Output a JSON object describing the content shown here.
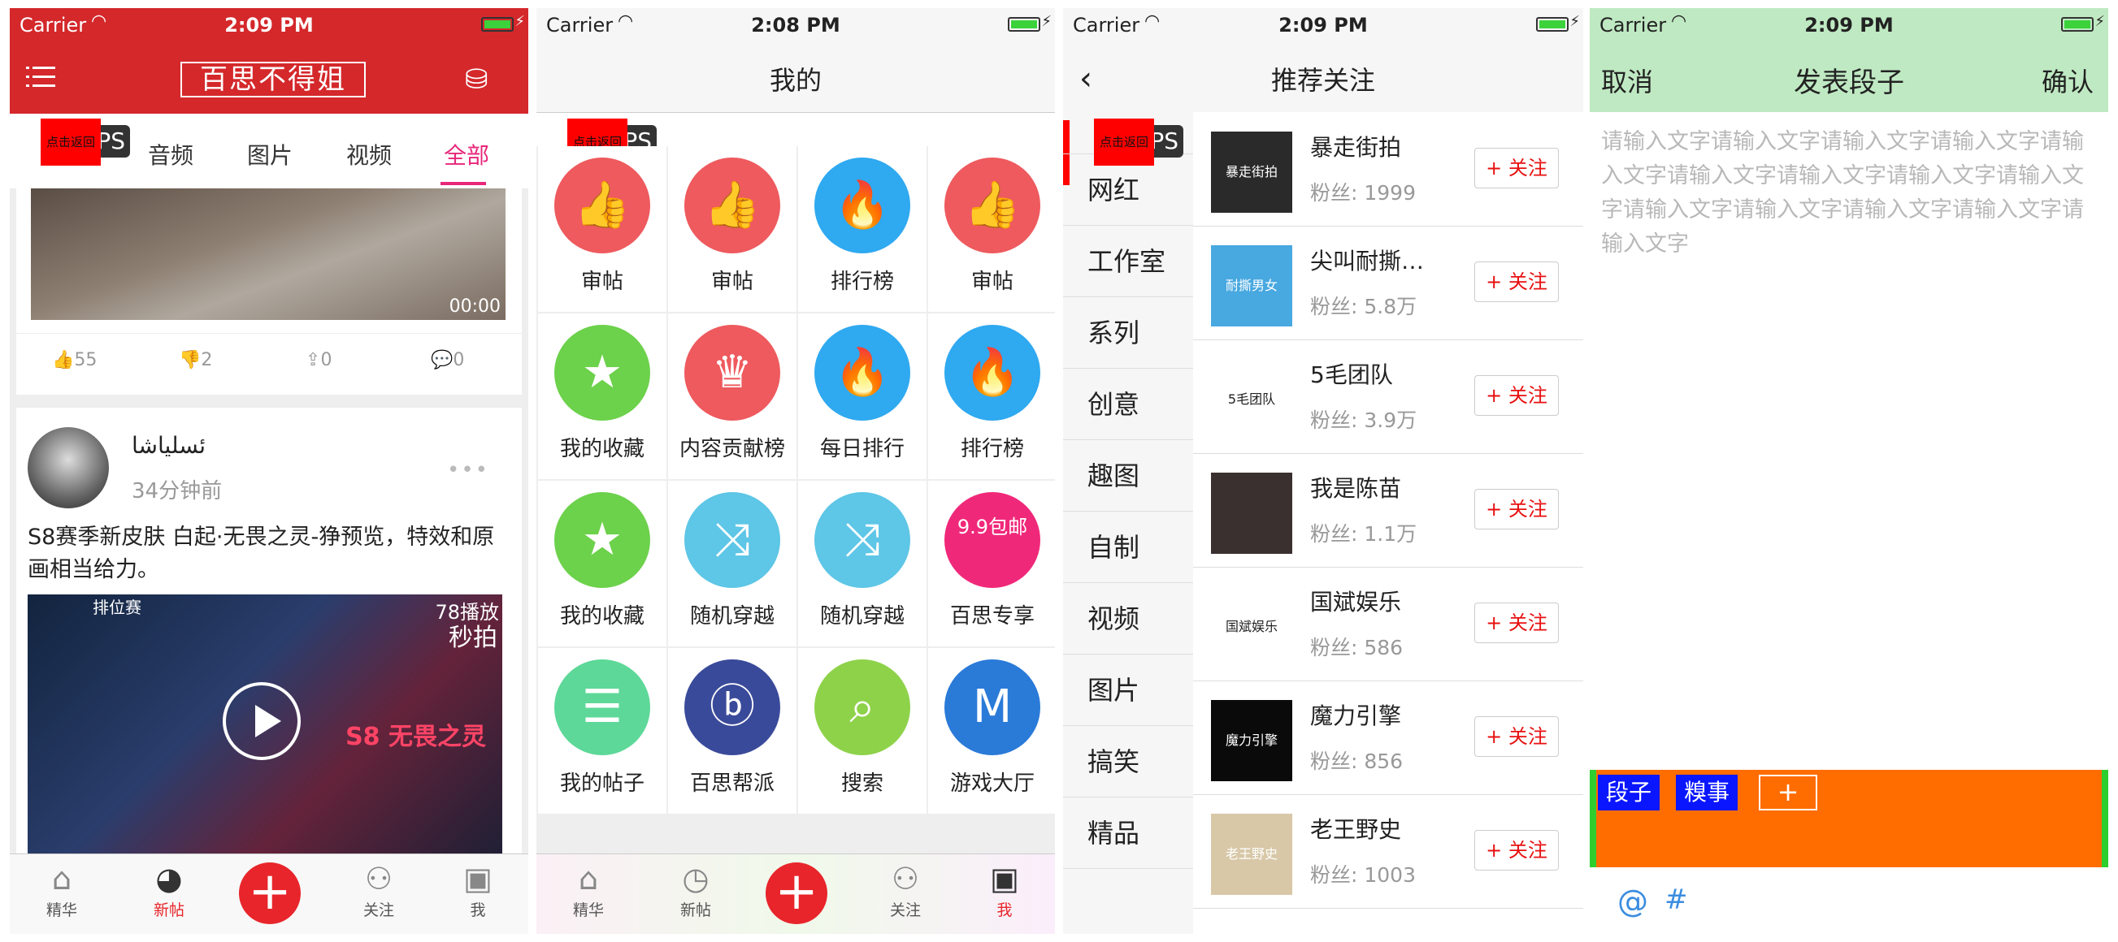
{
  "status": {
    "carrier": "Carrier",
    "times": [
      "2:09 PM",
      "2:08 PM",
      "2:09 PM",
      "2:09 PM"
    ]
  },
  "overlay": {
    "ps": "PS",
    "back_hint": "点击返回"
  },
  "home": {
    "logo": "百思不得姐",
    "tabs": [
      "音频",
      "图片",
      "视频",
      "全部"
    ],
    "video_duration": "00:00",
    "likes": "55",
    "dislikes": "2",
    "shares": "0",
    "comments": "0",
    "post_user": "ئسلياشا",
    "post_time": "34分钟前",
    "post_text": "S8赛季新皮肤 白起·无畏之灵-狰预览，特效和原画相当给力。",
    "play_count": "78播放",
    "video_brand": "秒拍",
    "rank_label": "排位赛",
    "skin_label": "S8 无畏之灵"
  },
  "tabbar": {
    "items": [
      "精华",
      "新帖",
      "关注",
      "我"
    ]
  },
  "me": {
    "title": "我的",
    "cells": [
      {
        "label": "审帖",
        "icon": "👍",
        "color": "#ee5a5e"
      },
      {
        "label": "审帖",
        "icon": "👍",
        "color": "#ee5a5e"
      },
      {
        "label": "排行榜",
        "icon": "🔥",
        "color": "#2fa9f0"
      },
      {
        "label": "审帖",
        "icon": "👍",
        "color": "#ee5a5e"
      },
      {
        "label": "我的收藏",
        "icon": "★",
        "color": "#6cd14b"
      },
      {
        "label": "内容贡献榜",
        "icon": "♛",
        "color": "#ee5a5e"
      },
      {
        "label": "每日排行",
        "icon": "🔥",
        "color": "#2fa9f0"
      },
      {
        "label": "排行榜",
        "icon": "🔥",
        "color": "#2fa9f0"
      },
      {
        "label": "我的收藏",
        "icon": "★",
        "color": "#6cd14b"
      },
      {
        "label": "随机穿越",
        "icon": "⤨",
        "color": "#5ec6e6"
      },
      {
        "label": "随机穿越",
        "icon": "⤨",
        "color": "#5ec6e6"
      },
      {
        "label": "百思专享",
        "icon": "9.9包邮",
        "color": "#f0287a"
      },
      {
        "label": "我的帖子",
        "icon": "☰",
        "color": "#5dd898"
      },
      {
        "label": "百思帮派",
        "icon": "ⓑ",
        "color": "#3a4a9a"
      },
      {
        "label": "搜索",
        "icon": "⌕",
        "color": "#8ed24a"
      },
      {
        "label": "游戏大厅",
        "icon": "M",
        "color": "#2a7ad8"
      }
    ]
  },
  "recommend": {
    "title": "推荐关注",
    "categories": [
      "",
      "网红",
      "工作室",
      "系列",
      "创意",
      "趣图",
      "自制",
      "视频",
      "图片",
      "搞笑",
      "精品"
    ],
    "follow_label": "+ 关注",
    "users": [
      {
        "name": "暴走街拍",
        "fans": "粉丝: 1999",
        "color": "#2a2a2a",
        "avatar_text": "暴走街拍"
      },
      {
        "name": "尖叫耐撕…",
        "fans": "粉丝: 5.8万",
        "color": "#48a8e0",
        "avatar_text": "耐撕男女"
      },
      {
        "name": "5毛团队",
        "fans": "粉丝: 3.9万",
        "color": "#ffffff",
        "avatar_text": "5毛团队"
      },
      {
        "name": "我是陈苗",
        "fans": "粉丝: 1.1万",
        "color": "#3a3030",
        "avatar_text": ""
      },
      {
        "name": "国斌娱乐",
        "fans": "粉丝: 586",
        "color": "#ffffff",
        "avatar_text": "国斌娱乐"
      },
      {
        "name": "魔力引擎",
        "fans": "粉丝: 856",
        "color": "#0a0a0a",
        "avatar_text": "魔力引擎"
      },
      {
        "name": "老王野史",
        "fans": "粉丝: 1003",
        "color": "#d8c8a8",
        "avatar_text": "老王野史"
      }
    ]
  },
  "compose": {
    "title": "发表段子",
    "cancel": "取消",
    "confirm": "确认",
    "placeholder": "请输入文字请输入文字请输入文字请输入文字请输入文字请输入文字请输入文字请输入文字请输入文字请输入文字请输入文字请输入文字请输入文字请输入文字",
    "tags": [
      "段子",
      "糗事"
    ],
    "add_tag": "+",
    "at_icon": "@",
    "hash_icon": "#"
  }
}
